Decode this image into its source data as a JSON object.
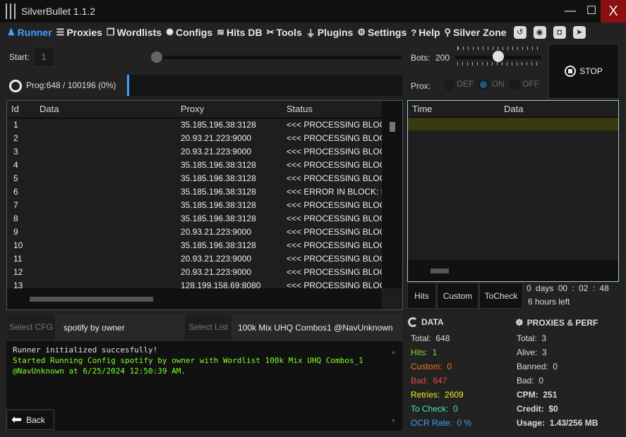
{
  "window": {
    "title": "SilverBullet 1.1.2",
    "minimize": "—",
    "maximize": "☐",
    "close": "X"
  },
  "nav": [
    {
      "label": "Runner",
      "icon": "runner-icon"
    },
    {
      "label": "Proxies",
      "icon": "server-icon"
    },
    {
      "label": "Wordlists",
      "icon": "files-icon"
    },
    {
      "label": "Configs",
      "icon": "gear-wheel-icon"
    },
    {
      "label": "Hits DB",
      "icon": "database-icon"
    },
    {
      "label": "Tools",
      "icon": "tools-icon"
    },
    {
      "label": "Plugins",
      "icon": "plug-icon"
    },
    {
      "label": "Settings",
      "icon": "gear-icon"
    },
    {
      "label": "Help",
      "icon": "help-icon"
    },
    {
      "label": "Silver Zone",
      "icon": "location-icon"
    }
  ],
  "nav_right_icons": [
    "history-icon",
    "camera-icon",
    "discord-icon",
    "telegram-icon"
  ],
  "runner": {
    "start_label": "Start:",
    "start_value": "1",
    "bots_label": "Bots:",
    "bots_value": "200",
    "bots_fraction": 0.5,
    "prog_label": "Prog:",
    "prog_text": "648 / 100196 (0%)",
    "prog_fraction": 0.0065,
    "prox_label": "Prox:",
    "prox_options": [
      "DEF",
      "ON",
      "OFF"
    ],
    "prox_selected": "ON",
    "stop_label": "STOP"
  },
  "grid": {
    "columns": [
      "Id",
      "Data",
      "Proxy",
      "Status"
    ],
    "rows": [
      [
        "1",
        "",
        "35.185.196.38:3128",
        "<<< PROCESSING BLOCK"
      ],
      [
        "2",
        "",
        "20.93.21.223:9000",
        "<<< PROCESSING BLOCK"
      ],
      [
        "3",
        "",
        "20.93.21.223:9000",
        "<<< PROCESSING BLOCK"
      ],
      [
        "4",
        "",
        "35.185.196.38:3128",
        "<<< PROCESSING BLOCK"
      ],
      [
        "5",
        "",
        "35.185.196.38:3128",
        "<<< PROCESSING BLOCK"
      ],
      [
        "6",
        "",
        "35.185.196.38:3128",
        "<<< ERROR IN BLOCK: R"
      ],
      [
        "7",
        "",
        "35.185.196.38:3128",
        "<<< PROCESSING BLOCK"
      ],
      [
        "8",
        "",
        "35.185.196.38:3128",
        "<<< PROCESSING BLOCK"
      ],
      [
        "9",
        "",
        "20.93.21.223:9000",
        "<<< PROCESSING BLOCK"
      ],
      [
        "10",
        "",
        "35.185.196.38:3128",
        "<<< PROCESSING BLOCK"
      ],
      [
        "11",
        "",
        "20.93.21.223:9000",
        "<<< PROCESSING BLOCK"
      ],
      [
        "12",
        "",
        "20.93.21.223:9000",
        "<<< PROCESSING BLOCK"
      ],
      [
        "13",
        "",
        "128.199.158.69:8080",
        "<<< PROCESSING BLOCK"
      ]
    ]
  },
  "hits": {
    "columns": [
      "Time",
      "Data"
    ],
    "rows": [
      [
        "",
        ""
      ]
    ]
  },
  "hit_tabs": [
    "Hits",
    "Custom",
    "ToCheck"
  ],
  "timer": {
    "days": "0",
    "days_label": "days",
    "time": "00 : 02 : 48",
    "left": "6 hours left"
  },
  "select": {
    "cfg_button": "Select CFG",
    "cfg_value": "spotify by owner",
    "list_button": "Select List",
    "list_value": "100k Mix UHQ Combos1 @NavUnknown"
  },
  "log": [
    {
      "text": "Runner initialized succesfully!",
      "color": "#e0e0e0"
    },
    {
      "text": "Started Running Config spotify by owner with Wordlist 100k Mix UHQ Combos_1 @NavUnknown at 6/25/2024 12:50:39 AM.",
      "color": "#7fff2a"
    }
  ],
  "back_label": "Back",
  "data": {
    "title": "DATA",
    "items": [
      {
        "label": "Total:",
        "value": "648",
        "color": "#dddddd"
      },
      {
        "label": "Hits:",
        "value": "1",
        "color": "#7fe02a"
      },
      {
        "label": "Custom:",
        "value": "0",
        "color": "#f07a10"
      },
      {
        "label": "Bad:",
        "value": "647",
        "color": "#f04848"
      },
      {
        "label": "Retries:",
        "value": "2609",
        "color": "#f0f020"
      },
      {
        "label": "To Check:",
        "value": "0",
        "color": "#50e0c0"
      },
      {
        "label": "OCR Rate:",
        "value": "0 %",
        "color": "#3f9fff"
      }
    ]
  },
  "perf": {
    "title": "PROXIES & PERF",
    "items": [
      {
        "label": "Total:",
        "value": "3",
        "bold": false
      },
      {
        "label": "Alive:",
        "value": "3",
        "bold": false
      },
      {
        "label": "Banned:",
        "value": "0",
        "bold": false
      },
      {
        "label": "Bad:",
        "value": "0",
        "bold": false
      },
      {
        "label": "CPM:",
        "value": "251",
        "bold": true
      },
      {
        "label": "Credit:",
        "value": "$0",
        "bold": true
      },
      {
        "label": "Usage:",
        "value": "1.43/256 MB",
        "bold": true
      }
    ]
  }
}
